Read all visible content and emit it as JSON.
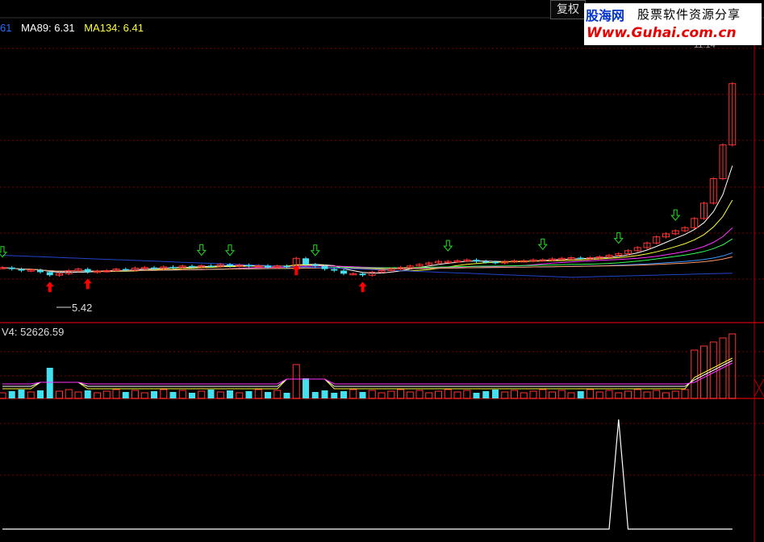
{
  "toolbar": {
    "fuquan_label": "复权"
  },
  "watermark": {
    "brand": "股海网",
    "slogan": "股票软件资源分享",
    "url": "Www.Guhai.com.cn"
  },
  "price_panel": {
    "header": [
      {
        "text": "61",
        "color": "#2b6cff"
      },
      {
        "text": "MA89: 6.31",
        "color": "#ffffff"
      },
      {
        "text": "MA134: 6.41",
        "color": "#ffff33"
      }
    ],
    "low_marker_label": "5.42",
    "partial_label": "11.14"
  },
  "volume_panel": {
    "header": "V4: 52626.59"
  },
  "colors": {
    "background": "#000000",
    "up": "#ff3333",
    "down": "#44e0f0",
    "grid": "#7a0000",
    "border": "#b00000",
    "buy_arrow": "#ff0000",
    "sell_arrow": "#22dd22"
  },
  "chart_data": [
    {
      "type": "candlestick",
      "panel": "price",
      "count": 78,
      "last_close": 11.14,
      "lowest_low": 5.42,
      "buy_signal_index": [
        5,
        9,
        31,
        38
      ],
      "sell_signal_index": [
        0,
        21,
        24,
        33,
        47,
        57,
        65,
        71
      ],
      "moving_averages": [
        {
          "name": "MA89",
          "last": 6.31
        },
        {
          "name": "MA134",
          "last": 6.41
        }
      ]
    },
    {
      "type": "bar",
      "panel": "volume",
      "series": [
        {
          "name": "V4",
          "last": 52626.59
        }
      ]
    },
    {
      "type": "line",
      "panel": "indicator",
      "values": [
        0,
        0,
        0,
        0,
        0,
        0,
        0,
        0,
        0,
        0,
        0,
        0,
        0,
        0,
        0,
        0,
        0,
        0,
        0,
        0,
        0,
        0,
        0,
        0,
        0,
        0,
        0,
        0,
        0,
        0,
        0,
        0,
        0,
        0,
        0,
        0,
        0,
        0,
        0,
        0,
        0,
        0,
        0,
        0,
        0,
        0,
        0,
        0,
        0,
        0,
        0,
        0,
        0,
        0,
        0,
        0,
        0,
        0,
        0,
        0,
        0,
        0,
        0,
        0,
        0,
        1,
        0,
        0,
        0,
        0,
        0,
        0,
        0,
        0,
        0,
        0,
        0,
        0
      ]
    }
  ]
}
